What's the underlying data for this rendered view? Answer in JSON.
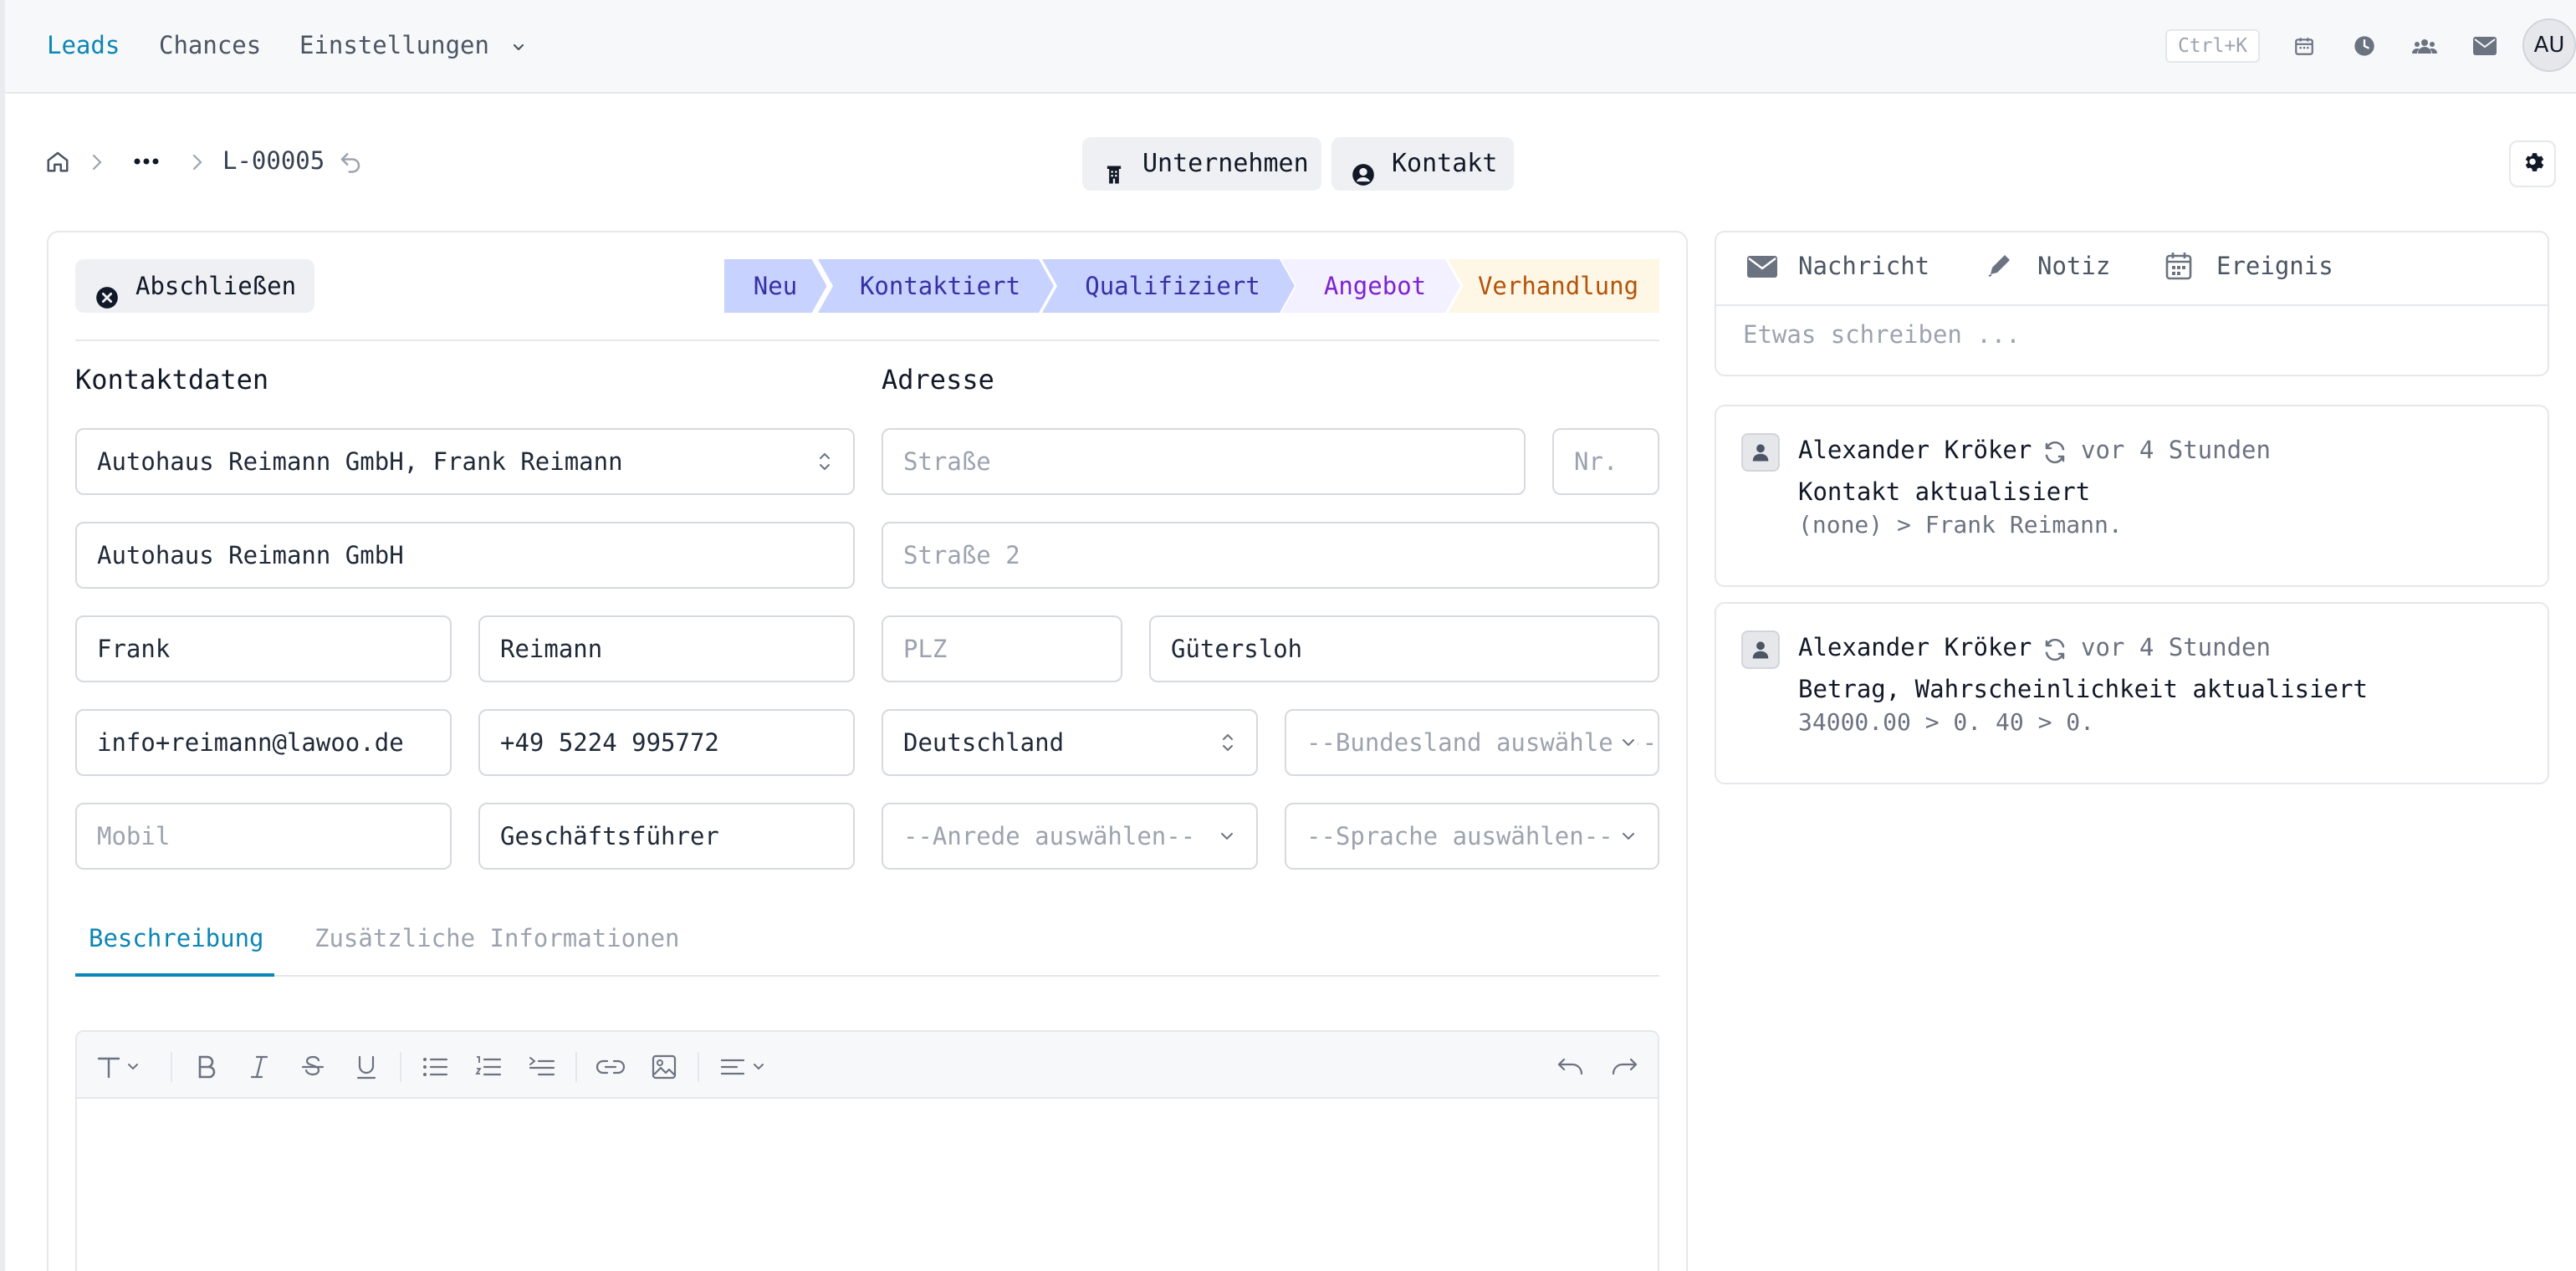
{
  "nav": {
    "items": [
      "Leads",
      "Chances",
      "Einstellungen"
    ],
    "shortcut": "Ctrl+K",
    "icons": [
      "calendar-icon",
      "clock-icon",
      "users-icon",
      "mail-icon"
    ],
    "avatar": "AU"
  },
  "breadcrumb": {
    "current": "L-00005"
  },
  "header_actions": {
    "company": "Unternehmen",
    "contact": "Kontakt"
  },
  "lead": {
    "close_label": "Abschließen",
    "stages": [
      {
        "label": "Neu",
        "bg": "#c7d2fe",
        "fg": "#3730a3"
      },
      {
        "label": "Kontaktiert",
        "bg": "#c7d2fe",
        "fg": "#3730a3"
      },
      {
        "label": "Qualifiziert",
        "bg": "#c7d2fe",
        "fg": "#3730a3"
      },
      {
        "label": "Angebot",
        "bg": "#f3f0ff",
        "fg": "#7e22ce"
      },
      {
        "label": "Verhandlung",
        "bg": "#fef7e6",
        "fg": "#b45309"
      }
    ]
  },
  "contact": {
    "title": "Kontaktdaten",
    "select": "Autohaus Reimann GmbH, Frank Reimann",
    "company": "Autohaus Reimann GmbH",
    "first_name": "Frank",
    "last_name": "Reimann",
    "email": "info+reimann@lawoo.de",
    "phone": "+49 5224 995772",
    "mobile_placeholder": "Mobil",
    "position": "Geschäftsführer"
  },
  "address": {
    "title": "Adresse",
    "street_placeholder": "Straße",
    "nr_placeholder": "Nr.",
    "street2_placeholder": "Straße 2",
    "zip_placeholder": "PLZ",
    "city": "Gütersloh",
    "country": "Deutschland",
    "state_placeholder": "--Bundesland auswählen--",
    "salutation_placeholder": "--Anrede auswählen--",
    "language_placeholder": "--Sprache auswählen--"
  },
  "tabs": {
    "description": "Beschreibung",
    "additional": "Zusätzliche Informationen"
  },
  "composer": {
    "message": "Nachricht",
    "note": "Notiz",
    "event": "Ereignis",
    "placeholder": "Etwas schreiben ..."
  },
  "activities": [
    {
      "user": "Alexander Kröker",
      "time": "vor 4 Stunden",
      "title": "Kontakt aktualisiert",
      "detail": "(none) > Frank Reimann."
    },
    {
      "user": "Alexander Kröker",
      "time": "vor 4 Stunden",
      "title": "Betrag, Wahrscheinlichkeit aktualisiert",
      "detail": "34000.00 > 0. 40 > 0."
    }
  ],
  "colors": {
    "accent": "#0b86b5",
    "border": "#d6d9de"
  }
}
